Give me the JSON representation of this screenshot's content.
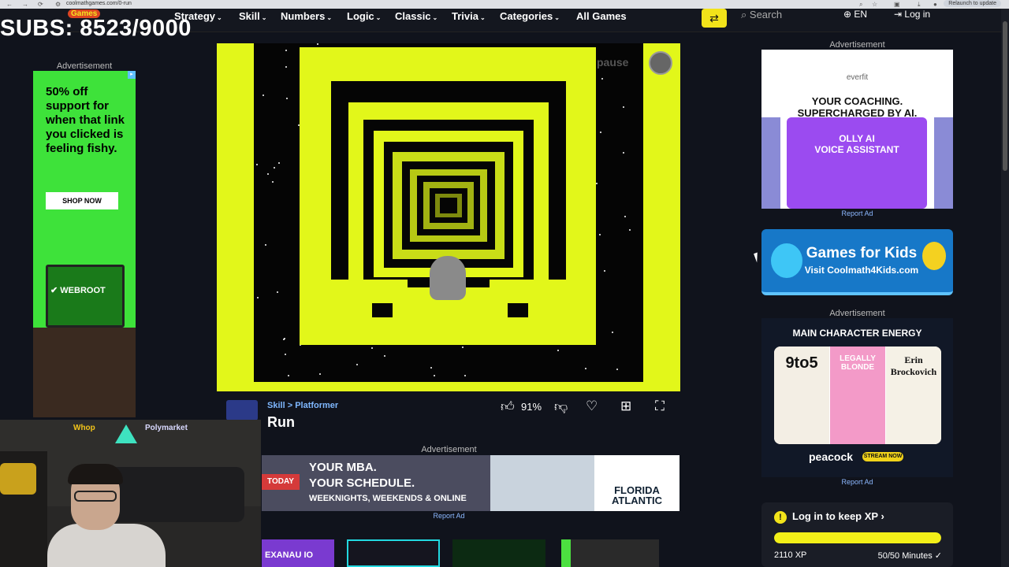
{
  "browser": {
    "url": "coolmathgames.com/0-run",
    "relaunch_label": "Relaunch to update"
  },
  "overlay": {
    "subs_text": "SUBS: 8523/9000"
  },
  "nav": {
    "logo": "Games",
    "items": [
      {
        "label": "Strategy"
      },
      {
        "label": "Skill"
      },
      {
        "label": "Numbers"
      },
      {
        "label": "Logic"
      },
      {
        "label": "Classic"
      },
      {
        "label": "Trivia"
      },
      {
        "label": "Categories"
      },
      {
        "label": "All Games"
      }
    ],
    "search_placeholder": "Search",
    "language": "EN",
    "login": "Log in"
  },
  "left_ad": {
    "label": "Advertisement",
    "text": "50% off support for when that link you clicked is feeling fishy.",
    "button": "SHOP NOW",
    "brand": "WEBROOT"
  },
  "game": {
    "pause_label": "pause",
    "breadcrumb_cat": "Skill",
    "breadcrumb_sep": ">",
    "breadcrumb_sub": "Platformer",
    "title": "Run",
    "rating": "91%"
  },
  "bottom_ad": {
    "label": "Advertisement",
    "today": "TODAY",
    "headline1": "YOUR MBA.",
    "headline2": "YOUR SCHEDULE.",
    "sub": "WEEKNIGHTS, WEEKENDS & ONLINE",
    "brand1": "FLORIDA",
    "brand2": "ATLANTIC",
    "report": "Report Ad"
  },
  "bottom_strip": {
    "tile_text": "EXANAU IO"
  },
  "right_ads": {
    "label1": "Advertisement",
    "everfit_brand": "everfit",
    "everfit_head1": "YOUR COACHING.",
    "everfit_head2": "SUPERCHARGED BY AI.",
    "everfit_card1": "OLLY AI",
    "everfit_card2": "VOICE ASSISTANT",
    "report1": "Report Ad",
    "kids_title": "Games for Kids",
    "kids_sub": "Visit Coolmath4Kids.com",
    "label2": "Advertisement",
    "peacock_head": "MAIN CHARACTER ENERGY",
    "poster1": "9to5",
    "poster2": "LEGALLY BLONDE",
    "poster3": "Erin Brockovich",
    "peacock_logo": "peacock",
    "stream_now": "STREAM NOW",
    "report2": "Report Ad"
  },
  "xp": {
    "login_text": "Log in to keep XP",
    "chevron": "›",
    "xp_value": "2110 XP",
    "minutes": "50/50 Minutes",
    "progress": 1.0
  },
  "webcam": {
    "whop": "Whop",
    "poly": "Polymarket"
  }
}
